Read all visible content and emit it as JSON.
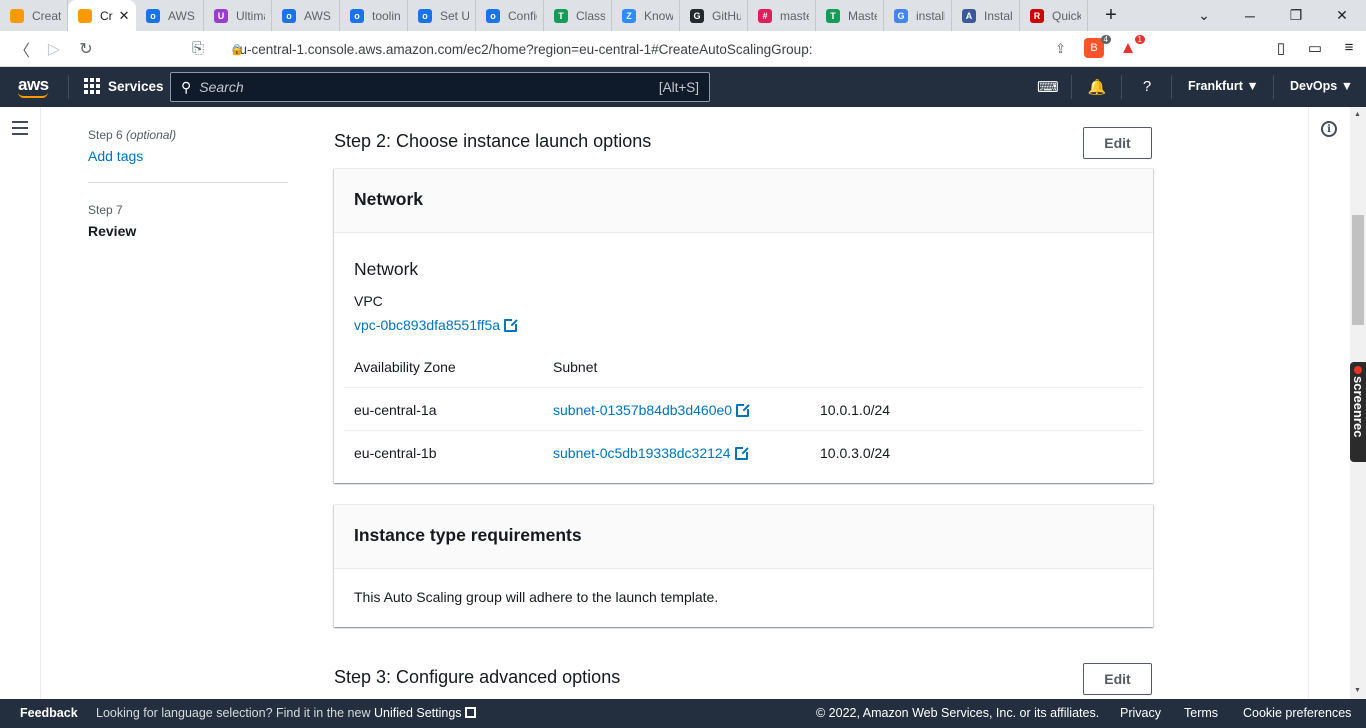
{
  "browser": {
    "tabs": [
      {
        "label": "Create",
        "color": "#ff9900",
        "glyph": ""
      },
      {
        "label": "Cr",
        "color": "#ff9900",
        "glyph": "",
        "active": true
      },
      {
        "label": "AWS S",
        "color": "#1a73e8",
        "glyph": "o"
      },
      {
        "label": "Ultima",
        "color": "#9b3ccf",
        "glyph": "U"
      },
      {
        "label": "AWS C",
        "color": "#1a73e8",
        "glyph": "o"
      },
      {
        "label": "toolin",
        "color": "#1a73e8",
        "glyph": "o"
      },
      {
        "label": "Set Up",
        "color": "#1a73e8",
        "glyph": "o"
      },
      {
        "label": "Config",
        "color": "#1a73e8",
        "glyph": "o"
      },
      {
        "label": "Class",
        "color": "#0f9d58",
        "glyph": "T"
      },
      {
        "label": "Know",
        "color": "#2d8cff",
        "glyph": "Z"
      },
      {
        "label": "GitHu",
        "color": "#24292e",
        "glyph": "G"
      },
      {
        "label": "maste",
        "color": "#e01e5a",
        "glyph": "#"
      },
      {
        "label": "Maste",
        "color": "#0f9d58",
        "glyph": "T"
      },
      {
        "label": "install",
        "color": "#4285f4",
        "glyph": "G"
      },
      {
        "label": "Install",
        "color": "#3b5998",
        "glyph": "A"
      },
      {
        "label": "Quick",
        "color": "#cc0000",
        "glyph": "R"
      }
    ],
    "url": "eu-central-1.console.aws.amazon.com/ec2/home?region=eu-central-1#CreateAutoScalingGroup:",
    "brave_badge": "4",
    "rewards_badge": "1"
  },
  "aws_header": {
    "logo": "aws",
    "services_label": "Services",
    "search_placeholder": "Search",
    "search_shortcut": "[Alt+S]",
    "region": "Frankfurt ▼",
    "account": "DevOps ▼"
  },
  "wizard_nav": {
    "step6_label": "Step 6",
    "step6_optional": "(optional)",
    "step6_title": "Add tags",
    "step7_label": "Step 7",
    "step7_title": "Review"
  },
  "step2": {
    "heading": "Step 2: Choose instance launch options",
    "edit_label": "Edit",
    "network_card": {
      "header": "Network",
      "section_title": "Network",
      "vpc_label": "VPC",
      "vpc_value": "vpc-0bc893dfa8551ff5a",
      "col_az": "Availability Zone",
      "col_subnet": "Subnet",
      "rows": [
        {
          "az": "eu-central-1a",
          "subnet": "subnet-01357b84db3d460e0",
          "cidr": "10.0.1.0/24"
        },
        {
          "az": "eu-central-1b",
          "subnet": "subnet-0c5db19338dc32124",
          "cidr": "10.0.3.0/24"
        }
      ]
    },
    "instance_card": {
      "header": "Instance type requirements",
      "text": "This Auto Scaling group will adhere to the launch template."
    }
  },
  "step3": {
    "heading": "Step 3: Configure advanced options",
    "edit_label": "Edit"
  },
  "footer": {
    "feedback": "Feedback",
    "lang_text": "Looking for language selection? Find it in the new",
    "unified": "Unified Settings",
    "copyright": "© 2022, Amazon Web Services, Inc. or its affiliates.",
    "privacy": "Privacy",
    "terms": "Terms",
    "cookies": "Cookie preferences"
  },
  "screenrec": "screenrec"
}
